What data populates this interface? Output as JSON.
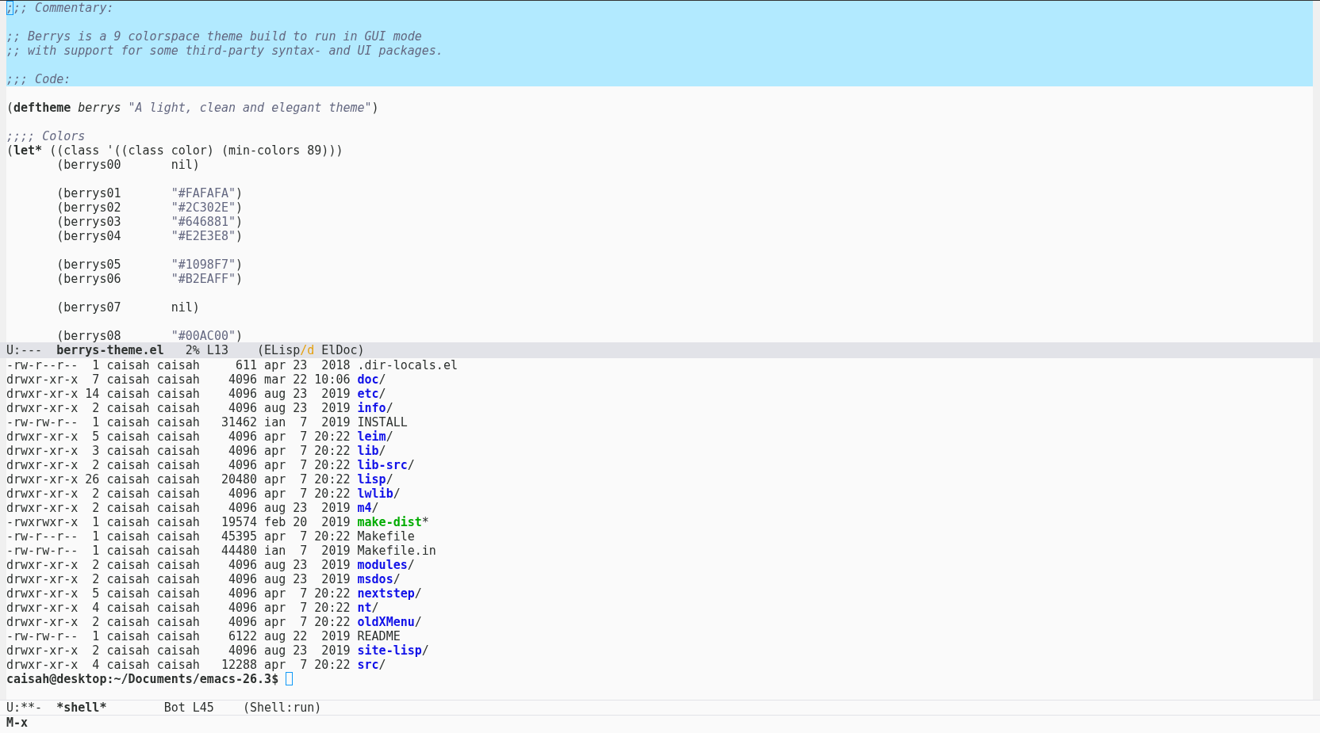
{
  "editor": {
    "lines": [
      {
        "highlighted": true,
        "segments": [
          {
            "text": ";",
            "kind": "comment",
            "cursor": true
          },
          {
            "text": ";; Commentary:",
            "kind": "comment"
          }
        ]
      },
      {
        "highlighted": true
      },
      {
        "highlighted": true,
        "segments": [
          {
            "text": ";; Berrys is a 9 colorspace theme build to run in GUI mode",
            "kind": "comment"
          }
        ]
      },
      {
        "highlighted": true,
        "segments": [
          {
            "text": ";; with support for some third-party syntax- and UI packages.",
            "kind": "comment"
          }
        ]
      },
      {
        "highlighted": true
      },
      {
        "highlighted": true,
        "segments": [
          {
            "text": ";;; Code:",
            "kind": "comment"
          }
        ]
      },
      {
        "highlighted": false
      },
      {
        "highlighted": false,
        "segments": [
          {
            "text": "(",
            "kind": "plain"
          },
          {
            "text": "deftheme",
            "kind": "keyword"
          },
          {
            "text": " berrys",
            "kind": "symbol"
          },
          {
            "text": " \"A light, clean and elegant theme\"",
            "kind": "docstring"
          },
          {
            "text": ")",
            "kind": "plain"
          }
        ]
      },
      {
        "highlighted": false
      },
      {
        "highlighted": false,
        "segments": [
          {
            "text": ";;;; Colors",
            "kind": "comment"
          }
        ]
      },
      {
        "highlighted": false,
        "segments": [
          {
            "text": "(",
            "kind": "plain"
          },
          {
            "text": "let*",
            "kind": "keyword"
          },
          {
            "text": " ((class '((class color) (min-colors 89)))",
            "kind": "plain"
          }
        ]
      },
      {
        "highlighted": false,
        "segments": [
          {
            "text": "       (berrys00       nil)",
            "kind": "plain"
          }
        ]
      },
      {
        "highlighted": false
      },
      {
        "highlighted": false,
        "segments": [
          {
            "text": "       (berrys01       ",
            "kind": "plain"
          },
          {
            "text": "\"#FAFAFA\"",
            "kind": "string"
          },
          {
            "text": ")",
            "kind": "plain"
          }
        ]
      },
      {
        "highlighted": false,
        "segments": [
          {
            "text": "       (berrys02       ",
            "kind": "plain"
          },
          {
            "text": "\"#2C302E\"",
            "kind": "string"
          },
          {
            "text": ")",
            "kind": "plain"
          }
        ]
      },
      {
        "highlighted": false,
        "segments": [
          {
            "text": "       (berrys03       ",
            "kind": "plain"
          },
          {
            "text": "\"#646881\"",
            "kind": "string"
          },
          {
            "text": ")",
            "kind": "plain"
          }
        ]
      },
      {
        "highlighted": false,
        "segments": [
          {
            "text": "       (berrys04       ",
            "kind": "plain"
          },
          {
            "text": "\"#E2E3E8\"",
            "kind": "string"
          },
          {
            "text": ")",
            "kind": "plain"
          }
        ]
      },
      {
        "highlighted": false
      },
      {
        "highlighted": false,
        "segments": [
          {
            "text": "       (berrys05       ",
            "kind": "plain"
          },
          {
            "text": "\"#1098F7\"",
            "kind": "string"
          },
          {
            "text": ")",
            "kind": "plain"
          }
        ]
      },
      {
        "highlighted": false,
        "segments": [
          {
            "text": "       (berrys06       ",
            "kind": "plain"
          },
          {
            "text": "\"#B2EAFF\"",
            "kind": "string"
          },
          {
            "text": ")",
            "kind": "plain"
          }
        ]
      },
      {
        "highlighted": false
      },
      {
        "highlighted": false,
        "segments": [
          {
            "text": "       (berrys07       nil)",
            "kind": "plain"
          }
        ]
      },
      {
        "highlighted": false
      },
      {
        "highlighted": false,
        "segments": [
          {
            "text": "       (berrys08       ",
            "kind": "plain"
          },
          {
            "text": "\"#00AC00\"",
            "kind": "string"
          },
          {
            "text": ")",
            "kind": "plain"
          }
        ]
      }
    ],
    "mode_line": {
      "active": true,
      "status": "U:---",
      "buffer": "berrys-theme.el",
      "position": "2% L13",
      "mode": [
        {
          "text": "(ELisp",
          "accent": false
        },
        {
          "text": "/d",
          "accent": true
        },
        {
          "text": " ElDoc)",
          "accent": false
        }
      ]
    }
  },
  "shell": {
    "rows": [
      {
        "info": "-rw-r--r--  1 caisah caisah     611 apr 23  2018",
        "name": ".dir-locals.el",
        "kind": "file"
      },
      {
        "info": "drwxr-xr-x  7 caisah caisah    4096 mar 22 10:06",
        "name": "doc",
        "suffix": "/",
        "kind": "dir"
      },
      {
        "info": "drwxr-xr-x 14 caisah caisah    4096 aug 23  2019",
        "name": "etc",
        "suffix": "/",
        "kind": "dir"
      },
      {
        "info": "drwxr-xr-x  2 caisah caisah    4096 aug 23  2019",
        "name": "info",
        "suffix": "/",
        "kind": "dir"
      },
      {
        "info": "-rw-rw-r--  1 caisah caisah   31462 ian  7  2019",
        "name": "INSTALL",
        "kind": "file"
      },
      {
        "info": "drwxr-xr-x  5 caisah caisah    4096 apr  7 20:22",
        "name": "leim",
        "suffix": "/",
        "kind": "dir"
      },
      {
        "info": "drwxr-xr-x  3 caisah caisah    4096 apr  7 20:22",
        "name": "lib",
        "suffix": "/",
        "kind": "dir"
      },
      {
        "info": "drwxr-xr-x  2 caisah caisah    4096 apr  7 20:22",
        "name": "lib-src",
        "suffix": "/",
        "kind": "dir"
      },
      {
        "info": "drwxr-xr-x 26 caisah caisah   20480 apr  7 20:22",
        "name": "lisp",
        "suffix": "/",
        "kind": "dir"
      },
      {
        "info": "drwxr-xr-x  2 caisah caisah    4096 apr  7 20:22",
        "name": "lwlib",
        "suffix": "/",
        "kind": "dir"
      },
      {
        "info": "drwxr-xr-x  2 caisah caisah    4096 aug 23  2019",
        "name": "m4",
        "suffix": "/",
        "kind": "dir"
      },
      {
        "info": "-rwxrwxr-x  1 caisah caisah   19574 feb 20  2019",
        "name": "make-dist",
        "suffix": "*",
        "kind": "exec"
      },
      {
        "info": "-rw-r--r--  1 caisah caisah   45395 apr  7 20:22",
        "name": "Makefile",
        "kind": "file"
      },
      {
        "info": "-rw-rw-r--  1 caisah caisah   44480 ian  7  2019",
        "name": "Makefile.in",
        "kind": "file"
      },
      {
        "info": "drwxr-xr-x  2 caisah caisah    4096 aug 23  2019",
        "name": "modules",
        "suffix": "/",
        "kind": "dir"
      },
      {
        "info": "drwxr-xr-x  2 caisah caisah    4096 aug 23  2019",
        "name": "msdos",
        "suffix": "/",
        "kind": "dir"
      },
      {
        "info": "drwxr-xr-x  5 caisah caisah    4096 apr  7 20:22",
        "name": "nextstep",
        "suffix": "/",
        "kind": "dir"
      },
      {
        "info": "drwxr-xr-x  4 caisah caisah    4096 apr  7 20:22",
        "name": "nt",
        "suffix": "/",
        "kind": "dir"
      },
      {
        "info": "drwxr-xr-x  2 caisah caisah    4096 apr  7 20:22",
        "name": "oldXMenu",
        "suffix": "/",
        "kind": "dir"
      },
      {
        "info": "-rw-rw-r--  1 caisah caisah    6122 aug 22  2019",
        "name": "README",
        "kind": "file"
      },
      {
        "info": "drwxr-xr-x  2 caisah caisah    4096 aug 23  2019",
        "name": "site-lisp",
        "suffix": "/",
        "kind": "dir"
      },
      {
        "info": "drwxr-xr-x  4 caisah caisah   12288 apr  7 20:22",
        "name": "src",
        "suffix": "/",
        "kind": "dir"
      }
    ],
    "prompt": {
      "text": "caisah@desktop:~/Documents/emacs-26.3$",
      "cursor": true
    },
    "mode_line": {
      "active": false,
      "status": "U:**-",
      "buffer": "*shell*",
      "position": "Bot L45",
      "mode": [
        {
          "text": "(Shell:run)",
          "accent": false
        }
      ]
    }
  },
  "minibuffer": {
    "text": "M-x"
  }
}
